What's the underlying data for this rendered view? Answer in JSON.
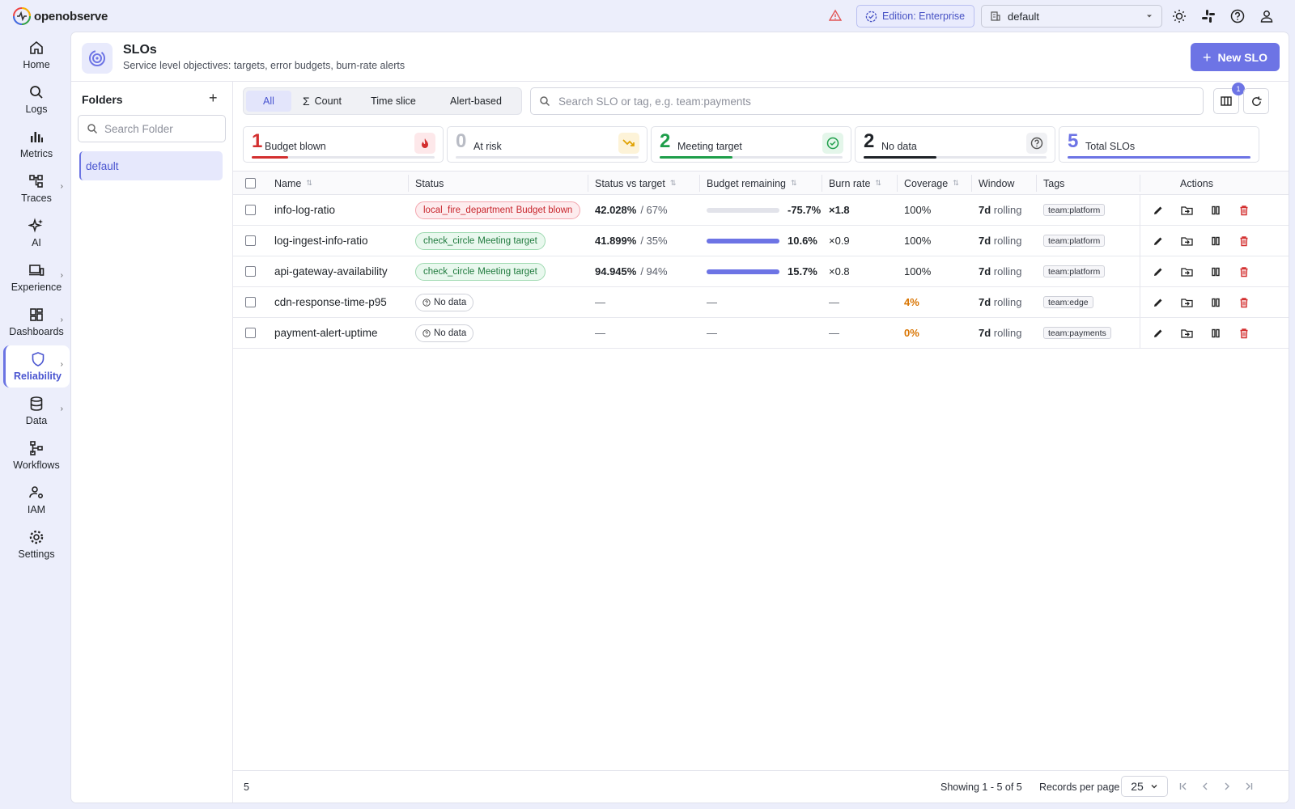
{
  "brand": {
    "name": "openobserve"
  },
  "topbar": {
    "edition": "Edition: Enterprise",
    "org": "default"
  },
  "nav": [
    {
      "label": "Home",
      "icon": "home-icon"
    },
    {
      "label": "Logs",
      "icon": "search-icon"
    },
    {
      "label": "Metrics",
      "icon": "bar-chart-icon"
    },
    {
      "label": "Traces",
      "icon": "traces-icon"
    },
    {
      "label": "AI",
      "icon": "sparkle-icon"
    },
    {
      "label": "Experience",
      "icon": "devices-icon"
    },
    {
      "label": "Dashboards",
      "icon": "dashboard-icon"
    },
    {
      "label": "Reliability",
      "icon": "shield-icon"
    },
    {
      "label": "Data",
      "icon": "database-icon"
    },
    {
      "label": "Workflows",
      "icon": "workflow-icon"
    },
    {
      "label": "IAM",
      "icon": "user-gear-icon"
    },
    {
      "label": "Settings",
      "icon": "gear-icon"
    }
  ],
  "page": {
    "title": "SLOs",
    "subtitle": "Service level objectives: targets, error budgets, burn-rate alerts",
    "new_button": "New SLO"
  },
  "folders": {
    "title": "Folders",
    "search_placeholder": "Search Folder",
    "items": [
      "default"
    ]
  },
  "filters": {
    "tabs": [
      "All",
      "Count",
      "Time slice",
      "Alert-based"
    ],
    "selected": "All",
    "search_placeholder": "Search SLO or tag, e.g. team:payments",
    "columns_badge": "1"
  },
  "summary": [
    {
      "count": "1",
      "label": "Budget blown",
      "fraction": 0.2,
      "color": "#d32f2f",
      "icon": "fire-icon"
    },
    {
      "count": "0",
      "label": "At risk",
      "fraction": 0,
      "color": "#e0a100",
      "icon": "trending-down-icon"
    },
    {
      "count": "2",
      "label": "Meeting target",
      "fraction": 0.4,
      "color": "#1e9e4a",
      "icon": "check-circle-icon"
    },
    {
      "count": "2",
      "label": "No data",
      "fraction": 0.4,
      "color": "#1f2328",
      "icon": "help-circle-icon"
    },
    {
      "count": "5",
      "label": "Total SLOs",
      "fraction": 1,
      "color": "#6d74e5",
      "icon": ""
    }
  ],
  "table": {
    "columns": [
      "Name",
      "Status",
      "Status vs target",
      "Budget remaining",
      "Burn rate",
      "Coverage",
      "Window",
      "Tags",
      "Actions"
    ],
    "rows": [
      {
        "name": "info-log-ratio",
        "status_icon": "local_fire_department",
        "status": "Budget blown",
        "kind": "blown",
        "actual": "42.028%",
        "target": "/ 67%",
        "budget": "-75.7%",
        "budget_fraction": 0,
        "burn": "×1.8",
        "coverage": "100%",
        "window_num": "7d",
        "window_txt": "rolling",
        "tag": "team:platform"
      },
      {
        "name": "log-ingest-info-ratio",
        "status_icon": "check_circle",
        "status": "Meeting target",
        "kind": "meet",
        "actual": "41.899%",
        "target": "/ 35%",
        "budget": "10.6%",
        "budget_fraction": 1,
        "burn": "×0.9",
        "coverage": "100%",
        "window_num": "7d",
        "window_txt": "rolling",
        "tag": "team:platform"
      },
      {
        "name": "api-gateway-availability",
        "status_icon": "check_circle",
        "status": "Meeting target",
        "kind": "meet",
        "actual": "94.945%",
        "target": "/ 94%",
        "budget": "15.7%",
        "budget_fraction": 1,
        "burn": "×0.8",
        "coverage": "100%",
        "window_num": "7d",
        "window_txt": "rolling",
        "tag": "team:platform"
      },
      {
        "name": "cdn-response-time-p95",
        "status_icon": "",
        "status": "No data",
        "kind": "nodata",
        "actual": "—",
        "target": "",
        "budget": "—",
        "budget_fraction": 0,
        "burn": "—",
        "coverage": "4%",
        "window_num": "7d",
        "window_txt": "rolling",
        "tag": "team:edge"
      },
      {
        "name": "payment-alert-uptime",
        "status_icon": "",
        "status": "No data",
        "kind": "nodata",
        "actual": "—",
        "target": "",
        "budget": "—",
        "budget_fraction": 0,
        "burn": "—",
        "coverage": "0%",
        "window_num": "7d",
        "window_txt": "rolling",
        "tag": "team:payments"
      }
    ]
  },
  "footer": {
    "count": "5",
    "showing": "Showing 1 - 5 of 5",
    "records_label": "Records per page",
    "records_value": "25"
  }
}
